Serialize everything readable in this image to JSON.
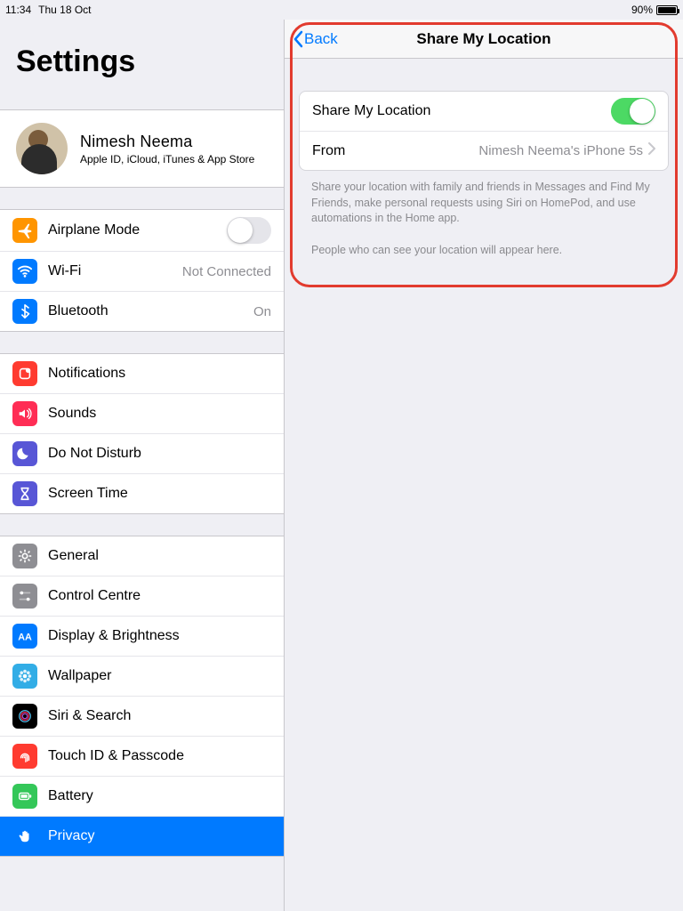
{
  "status": {
    "time": "11:34",
    "date": "Thu 18 Oct",
    "battery_pct": "90%",
    "battery_fill_pct": 90
  },
  "sidebar": {
    "title": "Settings",
    "profile": {
      "name": "Nimesh Neema",
      "subtitle": "Apple ID, iCloud, iTunes & App Store"
    },
    "group1": [
      {
        "icon": "airplane",
        "color": "bg-orange",
        "label": "Airplane Mode",
        "toggle": false
      },
      {
        "icon": "wifi",
        "color": "bg-blue",
        "label": "Wi-Fi",
        "value": "Not Connected"
      },
      {
        "icon": "bluetooth",
        "color": "bg-blue",
        "label": "Bluetooth",
        "value": "On"
      }
    ],
    "group2": [
      {
        "icon": "bell",
        "color": "bg-red",
        "label": "Notifications"
      },
      {
        "icon": "speaker",
        "color": "bg-darkred",
        "label": "Sounds"
      },
      {
        "icon": "moon",
        "color": "bg-purple",
        "label": "Do Not Disturb"
      },
      {
        "icon": "hourglass",
        "color": "bg-purple",
        "label": "Screen Time"
      }
    ],
    "group3": [
      {
        "icon": "gear",
        "color": "bg-gray",
        "label": "General"
      },
      {
        "icon": "switches",
        "color": "bg-gray",
        "label": "Control Centre"
      },
      {
        "icon": "aa",
        "color": "bg-blue",
        "label": "Display & Brightness"
      },
      {
        "icon": "flower",
        "color": "bg-teal",
        "label": "Wallpaper"
      },
      {
        "icon": "siri",
        "color": "bg-black",
        "label": "Siri & Search"
      },
      {
        "icon": "fingerprint",
        "color": "bg-red",
        "label": "Touch ID & Passcode"
      },
      {
        "icon": "battery",
        "color": "bg-green",
        "label": "Battery"
      },
      {
        "icon": "hand",
        "color": "bg-blue",
        "label": "Privacy",
        "selected": true
      }
    ]
  },
  "detail": {
    "back_label": "Back",
    "title": "Share My Location",
    "rows": {
      "share_label": "Share My Location",
      "share_on": true,
      "from_label": "From",
      "from_value": "Nimesh Neema's iPhone 5s"
    },
    "footer1": "Share your location with family and friends in Messages and Find My Friends, make personal requests using Siri on HomePod, and use automations in the Home app.",
    "footer2": "People who can see your location will appear here."
  }
}
